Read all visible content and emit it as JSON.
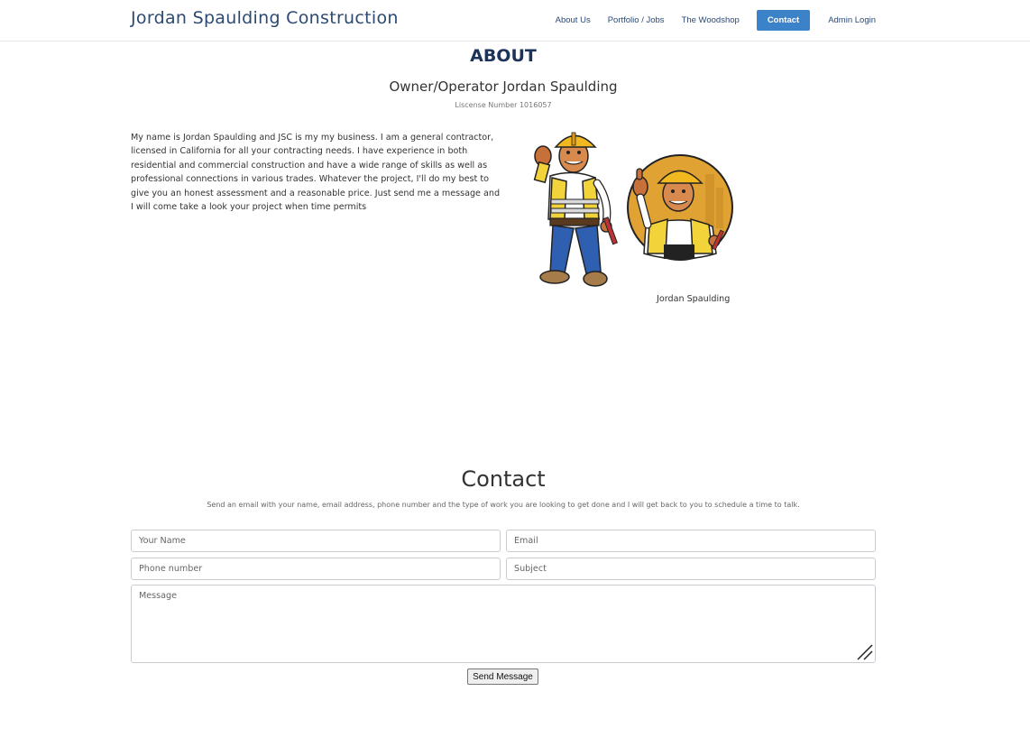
{
  "navbar": {
    "brand": "Jordan Spaulding Construction",
    "links": [
      "About Us",
      "Portfolio / Jobs",
      "The Woodshop",
      "Contact",
      "Admin Login"
    ],
    "active": "Contact"
  },
  "about": {
    "title": "ABOUT",
    "owner": "Owner/Operator Jordan Spaulding",
    "license": "Liscense Number 1016057",
    "bio": "My name is Jordan Spaulding and JSC is my my business. I am a general contractor, licensed in California for all your contracting needs. I have experience in both residential and commercial construction and have a wide range of skills as well as professional connections in various trades. Whatever the project, I'll do my best to give you an honest assessment and a reasonable price. Just send me a message and I will come take a look your project when time permits",
    "caption": "Jordan Spaulding"
  },
  "contact": {
    "title": "Contact",
    "subtitle": "Send an email with your name, email address, phone number and the type of work you are looking to get done and I will get back to you to schedule a time to talk.",
    "fields": {
      "name_placeholder": "Your Name",
      "email_placeholder": "Email",
      "phone_placeholder": "Phone number",
      "subject_placeholder": "Subject",
      "message_placeholder": "Message"
    },
    "send_label": "Send Message"
  },
  "colors": {
    "brand": "#2c4a72",
    "active_nav": "#3b82c9",
    "heading": "#1e3359",
    "hard_hat": "#f2b820",
    "vest": "#f3d33a",
    "badge_bg": "#e0a232"
  },
  "icons": [
    "worker-standing-illustration",
    "worker-badge-illustration",
    "resize-grip-icon"
  ]
}
